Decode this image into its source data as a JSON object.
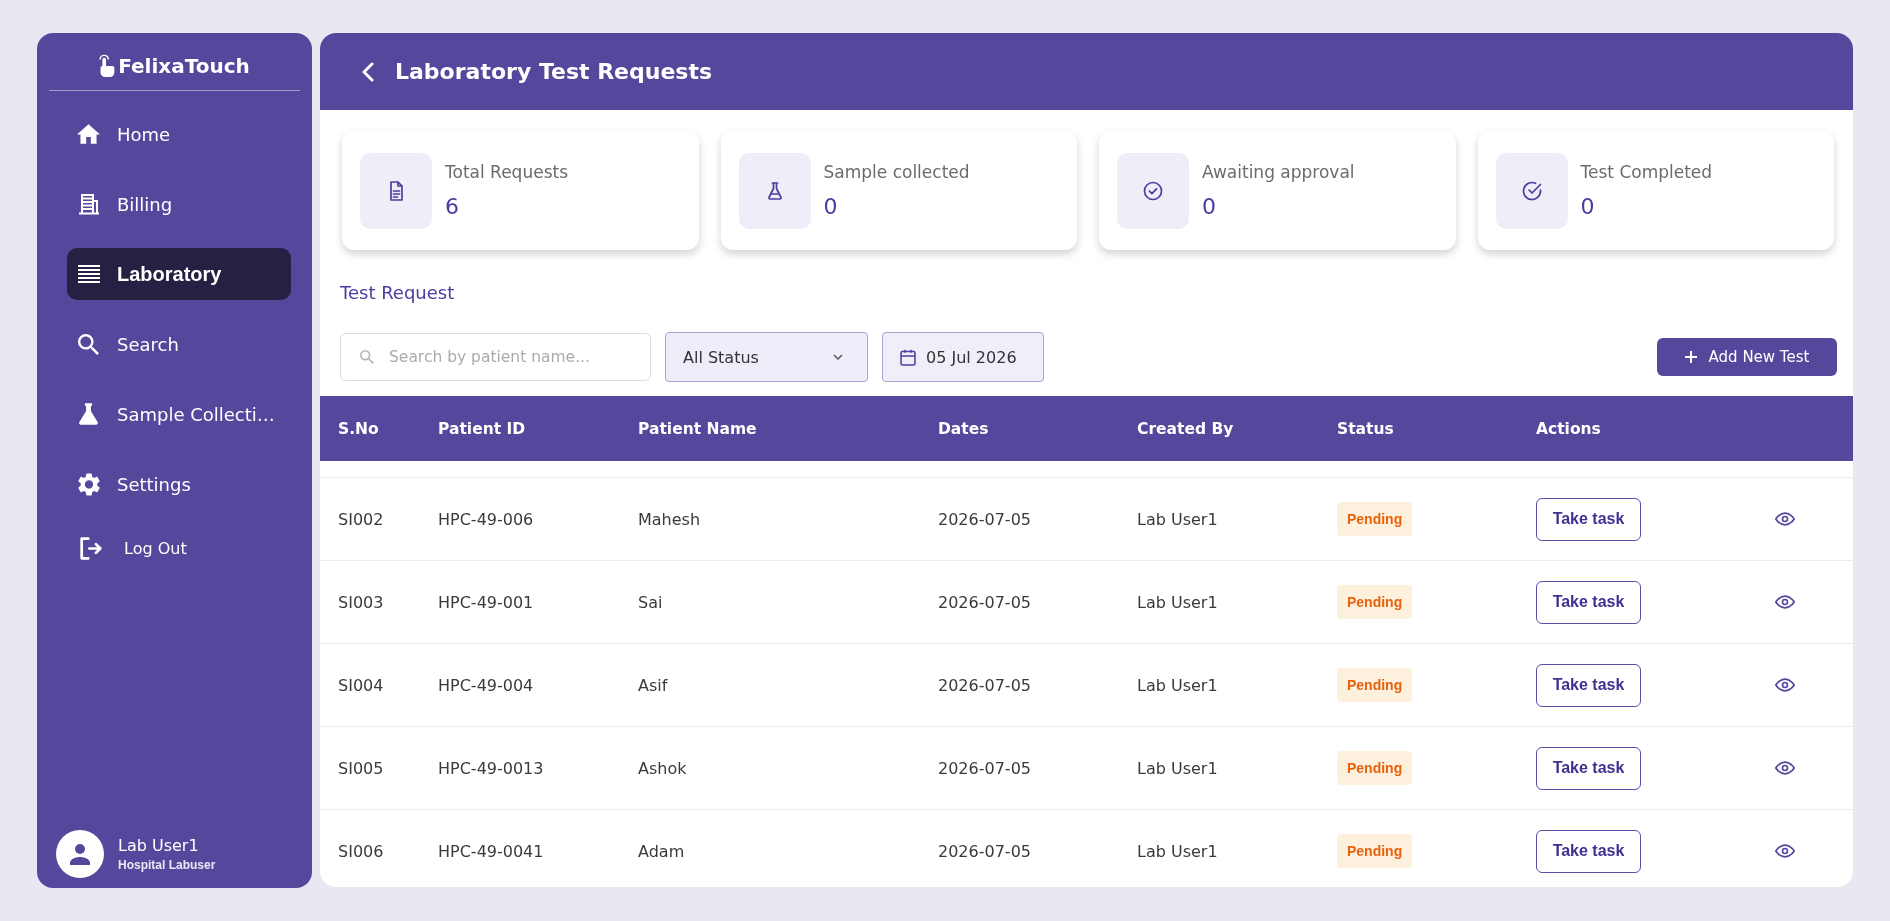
{
  "sidebar": {
    "logo": "FelixaTouch",
    "items": [
      {
        "label": "Home",
        "selected": false
      },
      {
        "label": "Billing",
        "selected": false
      },
      {
        "label": "Laboratory",
        "selected": true
      },
      {
        "label": "Search",
        "selected": false
      },
      {
        "label": "Sample Collecti…",
        "selected": false
      },
      {
        "label": "Settings",
        "selected": false
      }
    ],
    "logout": "Log Out",
    "user": {
      "name": "Lab User1",
      "role": "Hospital Labuser"
    }
  },
  "header": {
    "title": "Laboratory Test Requests"
  },
  "stats": [
    {
      "label": "Total Requests",
      "value": "6"
    },
    {
      "label": "Sample collected",
      "value": "0"
    },
    {
      "label": "Awaiting approval",
      "value": "0"
    },
    {
      "label": "Test Completed",
      "value": "0"
    }
  ],
  "section_title": "Test Request",
  "filters": {
    "search": {
      "placeholder": "Search by patient name..."
    },
    "status": "All Status",
    "date": "05 Jul 2026"
  },
  "add_button": "Add New Test",
  "table": {
    "columns": [
      "S.No",
      "Patient ID",
      "Patient Name",
      "Dates",
      "Created By",
      "Status",
      "Actions"
    ],
    "rows": [
      {
        "cells": [
          "SI002",
          "HPC-49-006",
          "Mahesh",
          "2026-07-05",
          "Lab User1"
        ],
        "status": "Pending",
        "action": "Take task"
      },
      {
        "cells": [
          "SI003",
          "HPC-49-001",
          "Sai",
          "2026-07-05",
          "Lab User1"
        ],
        "status": "Pending",
        "action": "Take task"
      },
      {
        "cells": [
          "SI004",
          "HPC-49-004",
          "Asif",
          "2026-07-05",
          "Lab User1"
        ],
        "status": "Pending",
        "action": "Take task"
      },
      {
        "cells": [
          "SI005",
          "HPC-49-0013",
          "Ashok",
          "2026-07-05",
          "Lab User1"
        ],
        "status": "Pending",
        "action": "Take task"
      },
      {
        "cells": [
          "SI006",
          "HPC-49-0041",
          "Adam",
          "2026-07-05",
          "Lab User1"
        ],
        "status": "Pending",
        "action": "Take task"
      }
    ]
  }
}
